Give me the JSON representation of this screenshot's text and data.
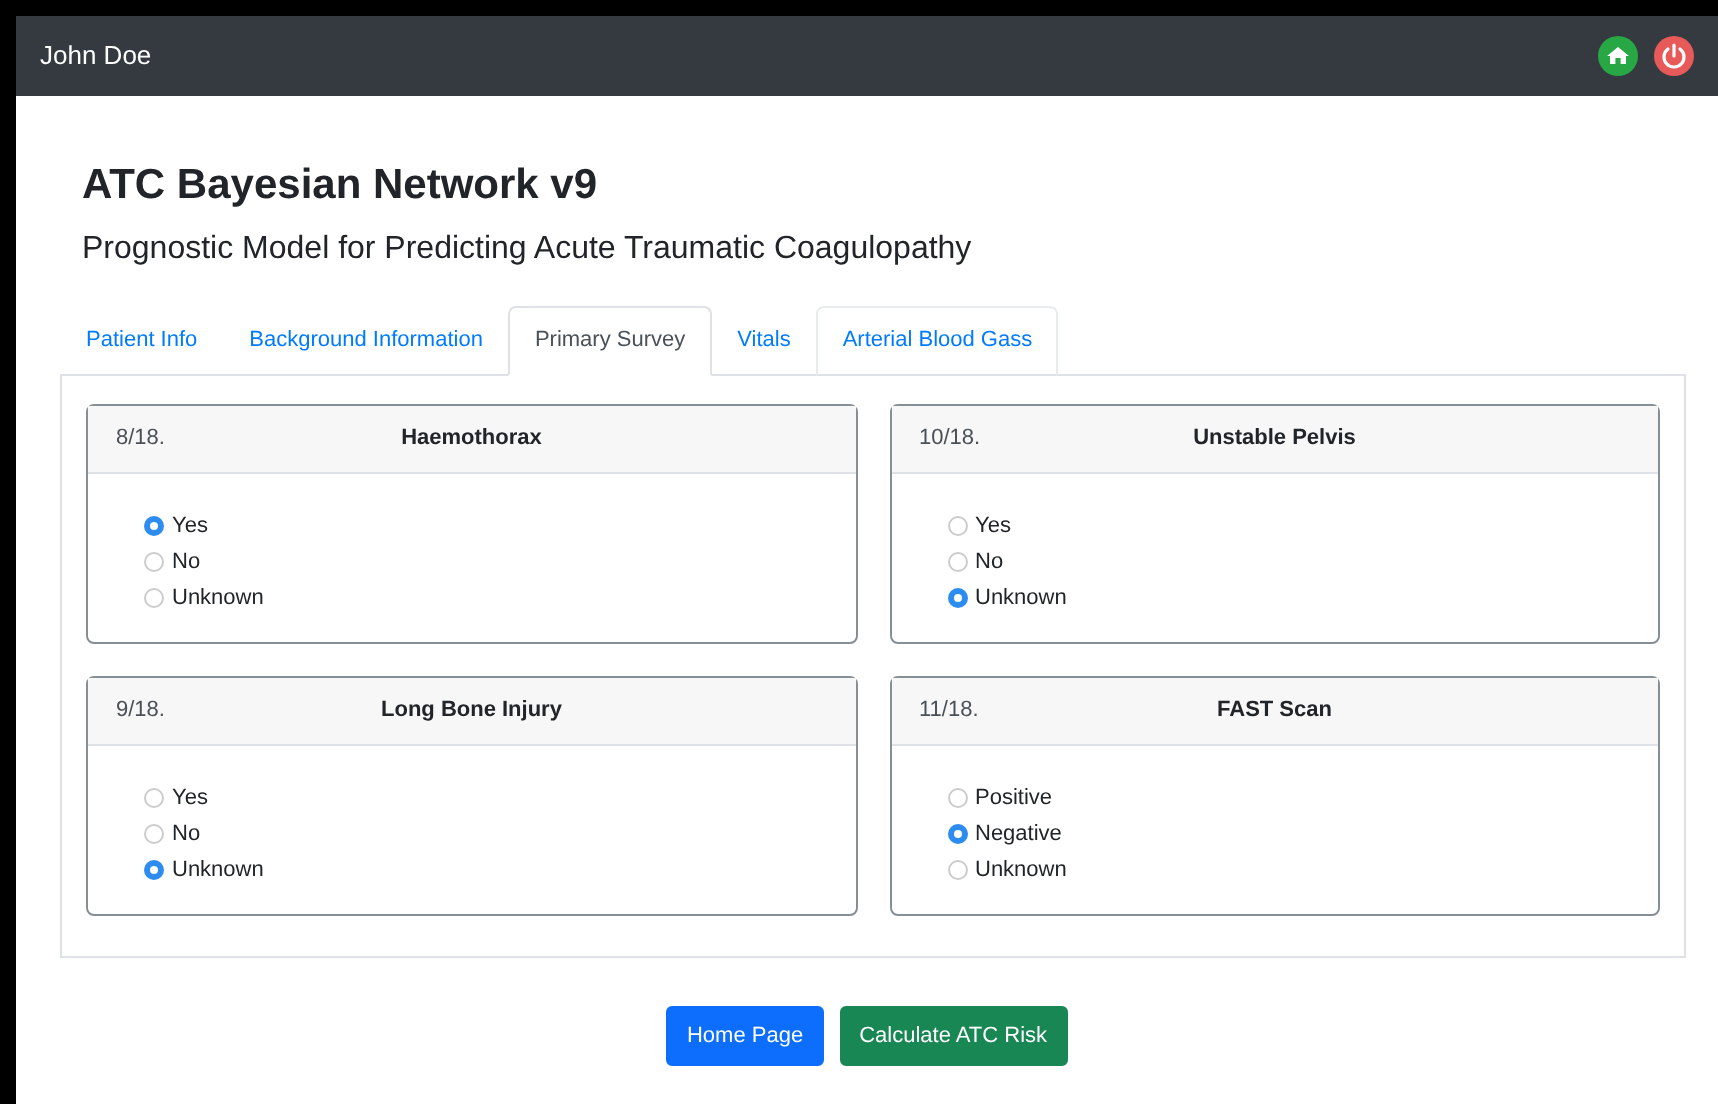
{
  "navbar": {
    "user": "John Doe"
  },
  "title": "ATC Bayesian Network v9",
  "subtitle": "Prognostic Model for Predicting Acute Traumatic Coagulopathy",
  "tabs": [
    {
      "label": "Patient Info",
      "selected": false
    },
    {
      "label": "Background Information",
      "selected": false
    },
    {
      "label": "Primary Survey",
      "selected": true
    },
    {
      "label": "Vitals",
      "selected": false
    },
    {
      "label": "Arterial Blood Gass",
      "selected": false
    }
  ],
  "questions": [
    {
      "number": "8/18.",
      "title": "Haemothorax",
      "options": [
        {
          "label": "Yes",
          "selected": true
        },
        {
          "label": "No",
          "selected": false
        },
        {
          "label": "Unknown",
          "selected": false
        }
      ]
    },
    {
      "number": "10/18.",
      "title": "Unstable Pelvis",
      "options": [
        {
          "label": "Yes",
          "selected": false
        },
        {
          "label": "No",
          "selected": false
        },
        {
          "label": "Unknown",
          "selected": true
        }
      ]
    },
    {
      "number": "9/18.",
      "title": "Long Bone Injury",
      "options": [
        {
          "label": "Yes",
          "selected": false
        },
        {
          "label": "No",
          "selected": false
        },
        {
          "label": "Unknown",
          "selected": true
        }
      ]
    },
    {
      "number": "11/18.",
      "title": "FAST Scan",
      "options": [
        {
          "label": "Positive",
          "selected": false
        },
        {
          "label": "Negative",
          "selected": true
        },
        {
          "label": "Unknown",
          "selected": false
        }
      ]
    }
  ],
  "buttons": [
    {
      "label": "Home Page",
      "kind": "primary"
    },
    {
      "label": "Calculate ATC Risk",
      "kind": "success"
    }
  ]
}
